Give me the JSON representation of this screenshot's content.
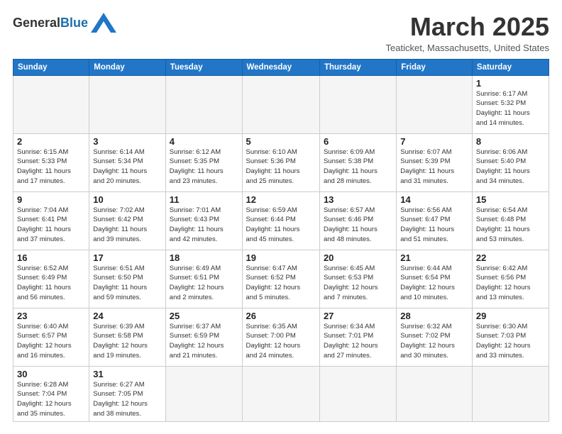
{
  "header": {
    "logo_general": "General",
    "logo_blue": "Blue",
    "month": "March 2025",
    "location": "Teaticket, Massachusetts, United States"
  },
  "weekdays": [
    "Sunday",
    "Monday",
    "Tuesday",
    "Wednesday",
    "Thursday",
    "Friday",
    "Saturday"
  ],
  "weeks": [
    [
      {
        "day": "",
        "info": ""
      },
      {
        "day": "",
        "info": ""
      },
      {
        "day": "",
        "info": ""
      },
      {
        "day": "",
        "info": ""
      },
      {
        "day": "",
        "info": ""
      },
      {
        "day": "",
        "info": ""
      },
      {
        "day": "1",
        "info": "Sunrise: 6:17 AM\nSunset: 5:32 PM\nDaylight: 11 hours\nand 14 minutes."
      }
    ],
    [
      {
        "day": "2",
        "info": "Sunrise: 6:15 AM\nSunset: 5:33 PM\nDaylight: 11 hours\nand 17 minutes."
      },
      {
        "day": "3",
        "info": "Sunrise: 6:14 AM\nSunset: 5:34 PM\nDaylight: 11 hours\nand 20 minutes."
      },
      {
        "day": "4",
        "info": "Sunrise: 6:12 AM\nSunset: 5:35 PM\nDaylight: 11 hours\nand 23 minutes."
      },
      {
        "day": "5",
        "info": "Sunrise: 6:10 AM\nSunset: 5:36 PM\nDaylight: 11 hours\nand 25 minutes."
      },
      {
        "day": "6",
        "info": "Sunrise: 6:09 AM\nSunset: 5:38 PM\nDaylight: 11 hours\nand 28 minutes."
      },
      {
        "day": "7",
        "info": "Sunrise: 6:07 AM\nSunset: 5:39 PM\nDaylight: 11 hours\nand 31 minutes."
      },
      {
        "day": "8",
        "info": "Sunrise: 6:06 AM\nSunset: 5:40 PM\nDaylight: 11 hours\nand 34 minutes."
      }
    ],
    [
      {
        "day": "9",
        "info": "Sunrise: 7:04 AM\nSunset: 6:41 PM\nDaylight: 11 hours\nand 37 minutes."
      },
      {
        "day": "10",
        "info": "Sunrise: 7:02 AM\nSunset: 6:42 PM\nDaylight: 11 hours\nand 39 minutes."
      },
      {
        "day": "11",
        "info": "Sunrise: 7:01 AM\nSunset: 6:43 PM\nDaylight: 11 hours\nand 42 minutes."
      },
      {
        "day": "12",
        "info": "Sunrise: 6:59 AM\nSunset: 6:44 PM\nDaylight: 11 hours\nand 45 minutes."
      },
      {
        "day": "13",
        "info": "Sunrise: 6:57 AM\nSunset: 6:46 PM\nDaylight: 11 hours\nand 48 minutes."
      },
      {
        "day": "14",
        "info": "Sunrise: 6:56 AM\nSunset: 6:47 PM\nDaylight: 11 hours\nand 51 minutes."
      },
      {
        "day": "15",
        "info": "Sunrise: 6:54 AM\nSunset: 6:48 PM\nDaylight: 11 hours\nand 53 minutes."
      }
    ],
    [
      {
        "day": "16",
        "info": "Sunrise: 6:52 AM\nSunset: 6:49 PM\nDaylight: 11 hours\nand 56 minutes."
      },
      {
        "day": "17",
        "info": "Sunrise: 6:51 AM\nSunset: 6:50 PM\nDaylight: 11 hours\nand 59 minutes."
      },
      {
        "day": "18",
        "info": "Sunrise: 6:49 AM\nSunset: 6:51 PM\nDaylight: 12 hours\nand 2 minutes."
      },
      {
        "day": "19",
        "info": "Sunrise: 6:47 AM\nSunset: 6:52 PM\nDaylight: 12 hours\nand 5 minutes."
      },
      {
        "day": "20",
        "info": "Sunrise: 6:45 AM\nSunset: 6:53 PM\nDaylight: 12 hours\nand 7 minutes."
      },
      {
        "day": "21",
        "info": "Sunrise: 6:44 AM\nSunset: 6:54 PM\nDaylight: 12 hours\nand 10 minutes."
      },
      {
        "day": "22",
        "info": "Sunrise: 6:42 AM\nSunset: 6:56 PM\nDaylight: 12 hours\nand 13 minutes."
      }
    ],
    [
      {
        "day": "23",
        "info": "Sunrise: 6:40 AM\nSunset: 6:57 PM\nDaylight: 12 hours\nand 16 minutes."
      },
      {
        "day": "24",
        "info": "Sunrise: 6:39 AM\nSunset: 6:58 PM\nDaylight: 12 hours\nand 19 minutes."
      },
      {
        "day": "25",
        "info": "Sunrise: 6:37 AM\nSunset: 6:59 PM\nDaylight: 12 hours\nand 21 minutes."
      },
      {
        "day": "26",
        "info": "Sunrise: 6:35 AM\nSunset: 7:00 PM\nDaylight: 12 hours\nand 24 minutes."
      },
      {
        "day": "27",
        "info": "Sunrise: 6:34 AM\nSunset: 7:01 PM\nDaylight: 12 hours\nand 27 minutes."
      },
      {
        "day": "28",
        "info": "Sunrise: 6:32 AM\nSunset: 7:02 PM\nDaylight: 12 hours\nand 30 minutes."
      },
      {
        "day": "29",
        "info": "Sunrise: 6:30 AM\nSunset: 7:03 PM\nDaylight: 12 hours\nand 33 minutes."
      }
    ],
    [
      {
        "day": "30",
        "info": "Sunrise: 6:28 AM\nSunset: 7:04 PM\nDaylight: 12 hours\nand 35 minutes."
      },
      {
        "day": "31",
        "info": "Sunrise: 6:27 AM\nSunset: 7:05 PM\nDaylight: 12 hours\nand 38 minutes."
      },
      {
        "day": "",
        "info": ""
      },
      {
        "day": "",
        "info": ""
      },
      {
        "day": "",
        "info": ""
      },
      {
        "day": "",
        "info": ""
      },
      {
        "day": "",
        "info": ""
      }
    ]
  ]
}
